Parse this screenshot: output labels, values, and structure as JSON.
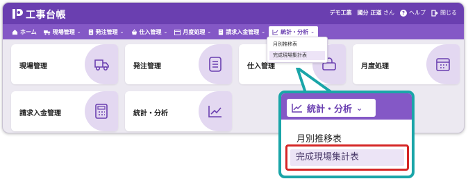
{
  "app": {
    "title": "工事台帳"
  },
  "header": {
    "company": "デモ工業",
    "user_name": "國分 正道",
    "user_suffix": "さん",
    "help_label": "ヘルプ",
    "close_label": "閉じる"
  },
  "nav": {
    "items": [
      {
        "label": "ホーム",
        "icon": "home-icon"
      },
      {
        "label": "現場管理",
        "icon": "truck-icon"
      },
      {
        "label": "発注管理",
        "icon": "document-icon"
      },
      {
        "label": "仕入管理",
        "icon": "basket-icon"
      },
      {
        "label": "月度処理",
        "icon": "calendar-icon"
      },
      {
        "label": "請求入金管理",
        "icon": "receipt-icon"
      },
      {
        "label": "統計・分析",
        "icon": "chart-icon",
        "active": true
      }
    ]
  },
  "dropdown": {
    "items": [
      {
        "label": "月別推移表"
      },
      {
        "label": "完成現場集計表",
        "selected": true
      }
    ]
  },
  "cards": [
    {
      "label": "現場管理",
      "icon": "truck-icon"
    },
    {
      "label": "発注管理",
      "icon": "document-icon"
    },
    {
      "label": "仕入管理",
      "icon": "basket-icon"
    },
    {
      "label": "月度処理",
      "icon": "calendar-icon"
    },
    {
      "label": "請求入金管理",
      "icon": "calculator-icon"
    },
    {
      "label": "統計・分析",
      "icon": "chart-icon"
    }
  ],
  "callout": {
    "menu_label": "統計・分析",
    "item1": "月別推移表",
    "item2": "完成現場集計表"
  },
  "colors": {
    "brand": "#6a3fb0",
    "nav": "#8458c6",
    "icon_bg": "#e3d8f1",
    "callout_border": "#1aa5a8",
    "highlight_border": "#d52525"
  }
}
